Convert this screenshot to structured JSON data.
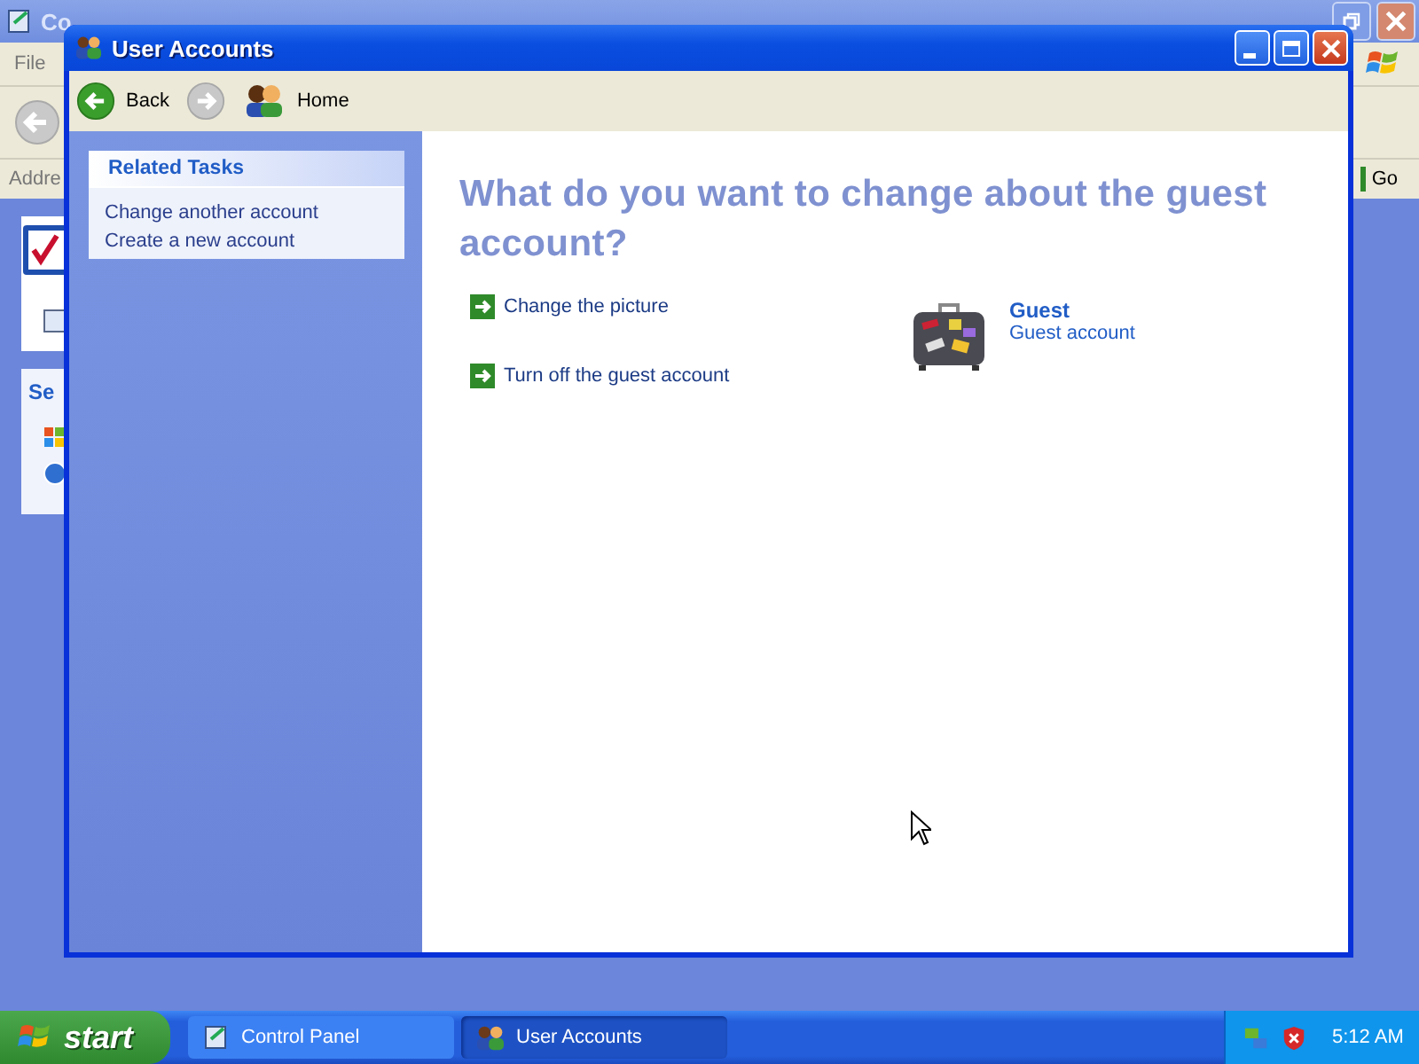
{
  "background_window": {
    "title": "Co",
    "menu": [
      "File"
    ],
    "address_label": "Addre",
    "go_button": "Go",
    "panel_heading": "Se"
  },
  "window": {
    "title": "User Accounts"
  },
  "toolbar": [
    {
      "kind": "back",
      "label": "Back",
      "disabled": false
    },
    {
      "kind": "forward",
      "disabled": true
    },
    {
      "kind": "home",
      "label": "Home",
      "disabled": false
    }
  ],
  "related_tasks": {
    "title": "Related Tasks",
    "items": [
      "Change another account",
      "Create a new account"
    ]
  },
  "heading": "What do you want to change about the guest account?",
  "tasks": [
    "Change the picture",
    "Turn off the guest account"
  ],
  "account": {
    "name": "Guest",
    "type": "Guest account"
  },
  "taskbar": {
    "start": "start",
    "items": [
      {
        "label": "Control Panel",
        "kind": "control-panel",
        "selected": false
      },
      {
        "label": "User Accounts",
        "kind": "users",
        "selected": true
      }
    ],
    "clock": "5:12 AM"
  }
}
